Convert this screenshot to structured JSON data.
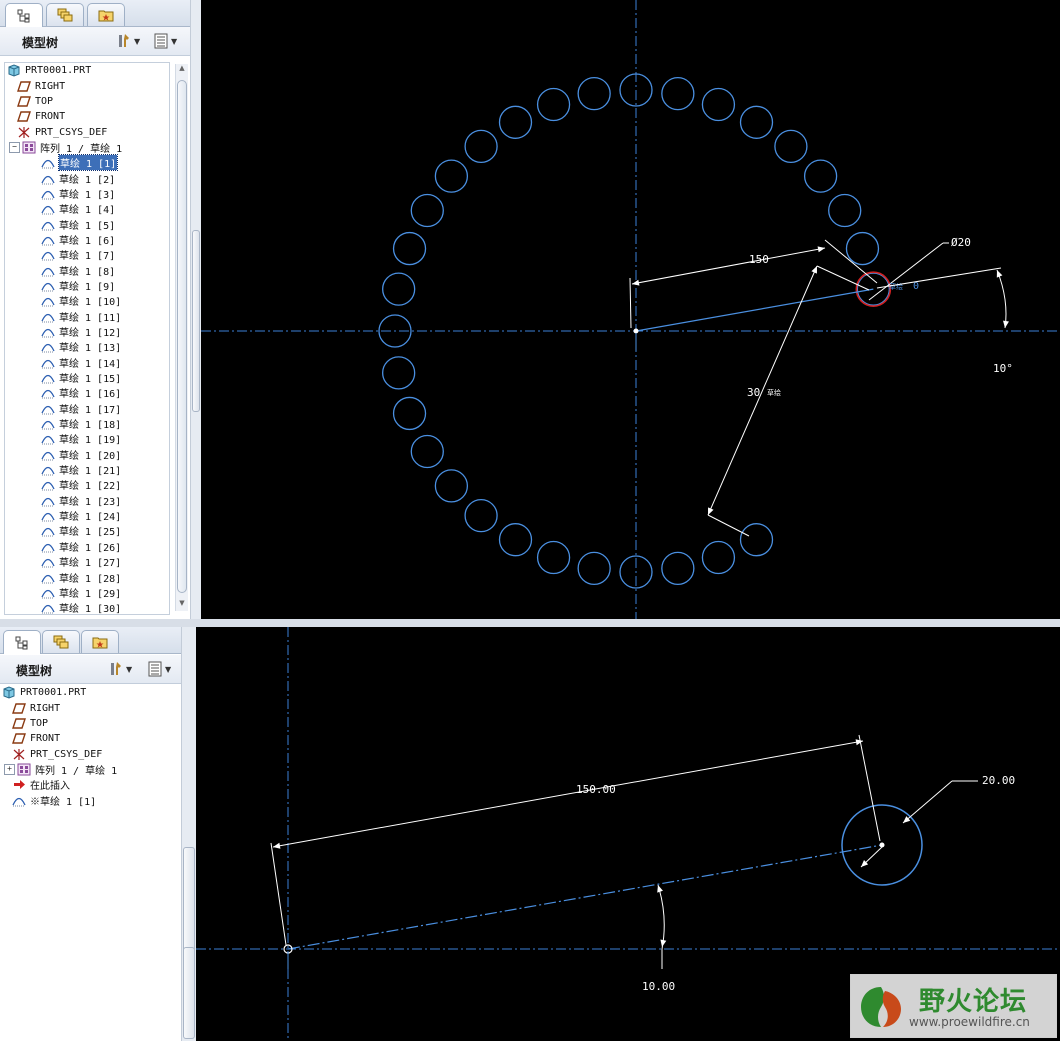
{
  "sidebar": {
    "title": "模型树",
    "tabs": [
      "model-tree-tab",
      "layers-tab",
      "favorites-tab"
    ]
  },
  "top": {
    "tree": [
      {
        "label": "PRT0001.PRT",
        "icon": "part-icon",
        "indent": 0
      },
      {
        "label": "RIGHT",
        "icon": "datum-plane-icon",
        "indent": 1
      },
      {
        "label": "TOP",
        "icon": "datum-plane-icon",
        "indent": 1
      },
      {
        "label": "FRONT",
        "icon": "datum-plane-icon",
        "indent": 1
      },
      {
        "label": "PRT_CSYS_DEF",
        "icon": "coordinate-system-icon",
        "indent": 1
      },
      {
        "label": "阵列 1 / 草绘 1",
        "icon": "pattern-icon",
        "indent": 1,
        "expander": "−"
      },
      {
        "label": "草绘 1 [1]",
        "icon": "sketch-icon",
        "indent": 2,
        "selected": true
      },
      {
        "label": "草绘 1 [2]",
        "icon": "sketch-icon",
        "indent": 2
      },
      {
        "label": "草绘 1 [3]",
        "icon": "sketch-icon",
        "indent": 2
      },
      {
        "label": "草绘 1 [4]",
        "icon": "sketch-icon",
        "indent": 2
      },
      {
        "label": "草绘 1 [5]",
        "icon": "sketch-icon",
        "indent": 2
      },
      {
        "label": "草绘 1 [6]",
        "icon": "sketch-icon",
        "indent": 2
      },
      {
        "label": "草绘 1 [7]",
        "icon": "sketch-icon",
        "indent": 2
      },
      {
        "label": "草绘 1 [8]",
        "icon": "sketch-icon",
        "indent": 2
      },
      {
        "label": "草绘 1 [9]",
        "icon": "sketch-icon",
        "indent": 2
      },
      {
        "label": "草绘 1 [10]",
        "icon": "sketch-icon",
        "indent": 2
      },
      {
        "label": "草绘 1 [11]",
        "icon": "sketch-icon",
        "indent": 2
      },
      {
        "label": "草绘 1 [12]",
        "icon": "sketch-icon",
        "indent": 2
      },
      {
        "label": "草绘 1 [13]",
        "icon": "sketch-icon",
        "indent": 2
      },
      {
        "label": "草绘 1 [14]",
        "icon": "sketch-icon",
        "indent": 2
      },
      {
        "label": "草绘 1 [15]",
        "icon": "sketch-icon",
        "indent": 2
      },
      {
        "label": "草绘 1 [16]",
        "icon": "sketch-icon",
        "indent": 2
      },
      {
        "label": "草绘 1 [17]",
        "icon": "sketch-icon",
        "indent": 2
      },
      {
        "label": "草绘 1 [18]",
        "icon": "sketch-icon",
        "indent": 2
      },
      {
        "label": "草绘 1 [19]",
        "icon": "sketch-icon",
        "indent": 2
      },
      {
        "label": "草绘 1 [20]",
        "icon": "sketch-icon",
        "indent": 2
      },
      {
        "label": "草绘 1 [21]",
        "icon": "sketch-icon",
        "indent": 2
      },
      {
        "label": "草绘 1 [22]",
        "icon": "sketch-icon",
        "indent": 2
      },
      {
        "label": "草绘 1 [23]",
        "icon": "sketch-icon",
        "indent": 2
      },
      {
        "label": "草绘 1 [24]",
        "icon": "sketch-icon",
        "indent": 2
      },
      {
        "label": "草绘 1 [25]",
        "icon": "sketch-icon",
        "indent": 2
      },
      {
        "label": "草绘 1 [26]",
        "icon": "sketch-icon",
        "indent": 2
      },
      {
        "label": "草绘 1 [27]",
        "icon": "sketch-icon",
        "indent": 2
      },
      {
        "label": "草绘 1 [28]",
        "icon": "sketch-icon",
        "indent": 2
      },
      {
        "label": "草绘 1 [29]",
        "icon": "sketch-icon",
        "indent": 2
      },
      {
        "label": "草绘 1 [30]",
        "icon": "sketch-icon",
        "indent": 2
      }
    ],
    "dims": {
      "distance": "150",
      "diameter": "Ø20",
      "angle": "10°",
      "count": "30",
      "count_tag": "草绘",
      "param_tag": "草绘",
      "param_value": "0"
    }
  },
  "bottom": {
    "tree": [
      {
        "label": "PRT0001.PRT",
        "icon": "part-icon",
        "indent": 0
      },
      {
        "label": "RIGHT",
        "icon": "datum-plane-icon",
        "indent": 1
      },
      {
        "label": "TOP",
        "icon": "datum-plane-icon",
        "indent": 1
      },
      {
        "label": "FRONT",
        "icon": "datum-plane-icon",
        "indent": 1
      },
      {
        "label": "PRT_CSYS_DEF",
        "icon": "coordinate-system-icon",
        "indent": 1
      },
      {
        "label": "阵列 1 / 草绘 1",
        "icon": "pattern-icon",
        "indent": 1,
        "expander": "+"
      },
      {
        "label": "在此插入",
        "icon": "insert-here-icon",
        "indent": 1
      },
      {
        "label": "※草绘 1 [1]",
        "icon": "sketch-icon",
        "indent": 1
      }
    ],
    "dims": {
      "distance": "150.00",
      "diameter": "20.00",
      "angle": "10.00"
    }
  },
  "watermark": {
    "title": "野火论坛",
    "url": "www.proewildfire.cn"
  },
  "colors": {
    "sketch_blue": "#4a8fe0",
    "centerline": "#3d7fd6",
    "dimension": "#ffffff",
    "highlight_red": "#d02020",
    "selection": "#3d6fb8"
  }
}
